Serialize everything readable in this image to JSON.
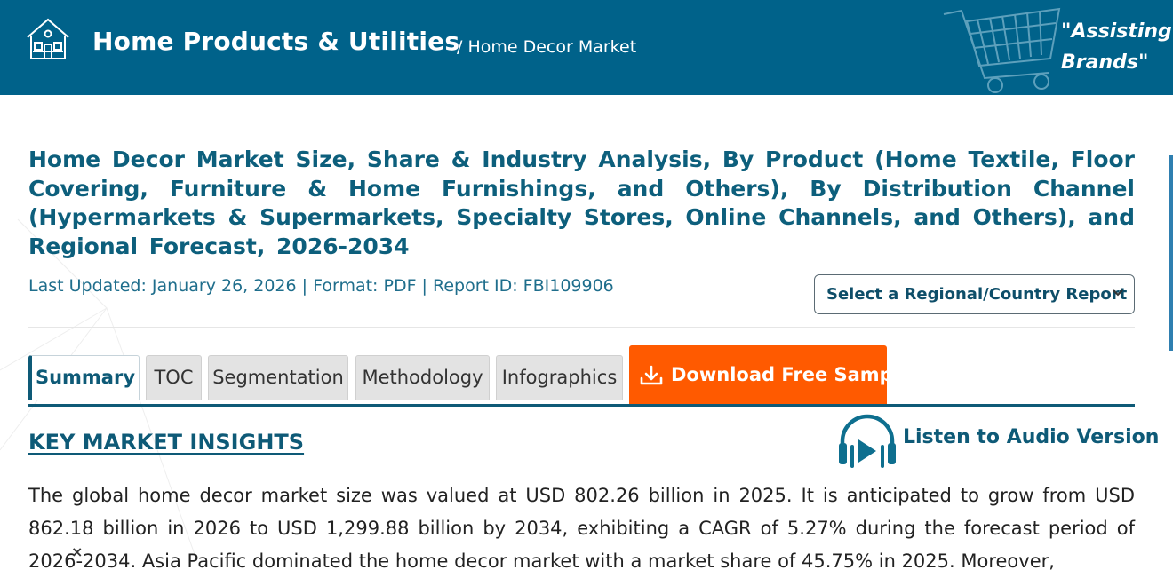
{
  "header": {
    "brand_title": "Home Products & Utilities",
    "breadcrumb": "/ Home Decor Market",
    "tagline_line1": "\"Assisting V",
    "tagline_line2": "Brands\"",
    "icons": [
      "house-icon",
      "shopping-cart-icon"
    ]
  },
  "report": {
    "title": "Home Decor Market Size, Share & Industry Analysis, By Product (Home Textile, Floor Covering, Furniture & Home Furnishings, and Others), By Distribution Channel (Hypermarkets & Supermarkets, Specialty Stores, Online Channels, and Others), and Regional Forecast, 2026-2034",
    "meta": "Last Updated: January 26, 2026 | Format: PDF | Report ID: FBI109906",
    "region_select": "Select a Regional/Country Report"
  },
  "tabs": {
    "summary": "Summary",
    "toc": "TOC",
    "segmentation": "Segmentation",
    "methodology": "Methodology",
    "infographics": "Infographics",
    "download": "Download Free Sample"
  },
  "content": {
    "heading": "KEY MARKET INSIGHTS",
    "audio_label": "Listen to Audio Version",
    "summary": "The global home decor market size was valued at USD 802.26 billion in 2025. It is anticipated to grow from USD 862.18 billion in 2026 to USD 1,299.88 billion by 2034, exhibiting a CAGR of 5.27% during the forecast period of 2026-2034. Asia Pacific dominated the home decor market with a market share of 45.75% in 2025. Moreover,",
    "close_glyph": "×"
  },
  "colors": {
    "header_bg": "#00628a",
    "title_blue": "#0d5f7c",
    "download_orange": "#ff5a00"
  }
}
